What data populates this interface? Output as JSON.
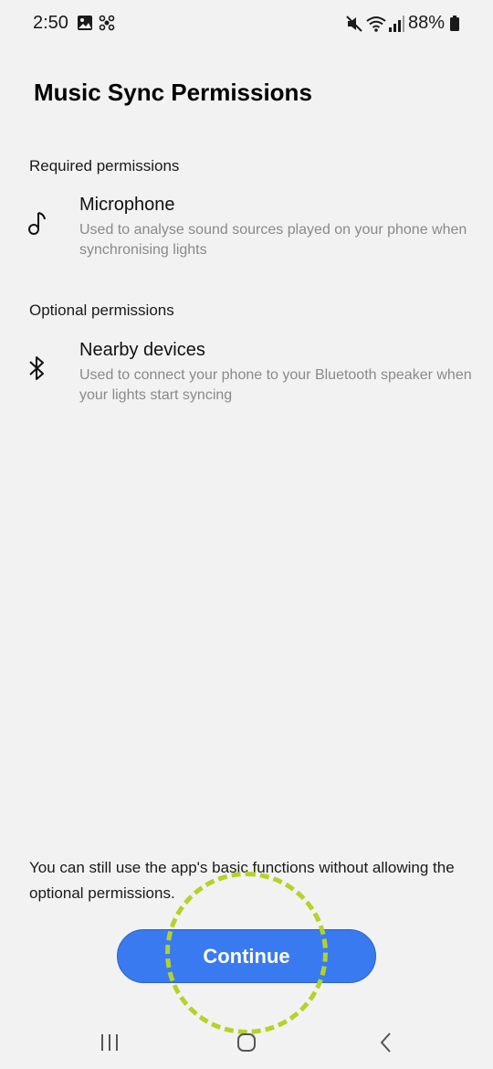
{
  "status_bar": {
    "time": "2:50",
    "battery": "88%",
    "icons": [
      "gallery-icon",
      "app-notification-icon",
      "mute-icon",
      "wifi-icon",
      "signal-icon",
      "battery-icon"
    ]
  },
  "title": "Music Sync Permissions",
  "required": {
    "label": "Required permissions",
    "item": {
      "icon": "music-note-icon",
      "title": "Microphone",
      "description": "Used to analyse sound sources played on your phone when synchronising lights"
    }
  },
  "optional": {
    "label": "Optional permissions",
    "item": {
      "icon": "bluetooth-icon",
      "title": "Nearby devices",
      "description": "Used to connect your phone to your Bluetooth speaker when your lights start syncing"
    }
  },
  "footer_note": "You can still use the app's basic functions without allowing the optional permissions.",
  "continue_label": "Continue",
  "colors": {
    "background": "#f2f2f2",
    "button": "#3a7af0",
    "highlight": "#b5d327",
    "secondary_text": "#8a8a8a"
  },
  "nav_bar": {
    "buttons": [
      "recents-icon",
      "home-icon",
      "back-icon"
    ]
  }
}
